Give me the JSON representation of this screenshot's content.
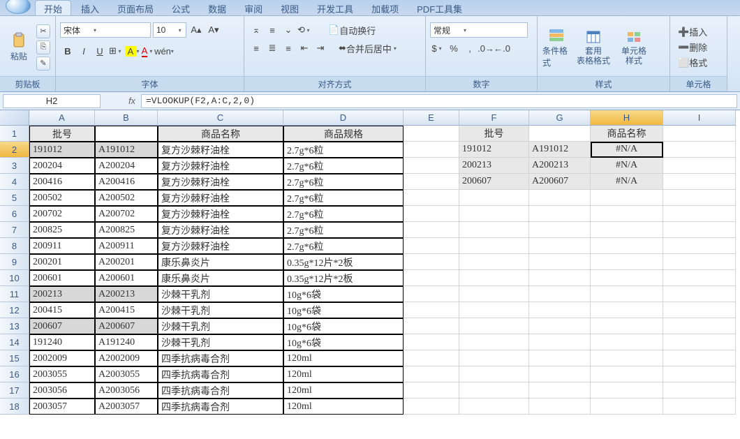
{
  "tabs": [
    "开始",
    "插入",
    "页面布局",
    "公式",
    "数据",
    "审阅",
    "视图",
    "开发工具",
    "加载项",
    "PDF工具集"
  ],
  "activeTab": 0,
  "ribbon": {
    "clipboard": {
      "label": "剪贴板",
      "paste": "粘贴"
    },
    "font": {
      "label": "字体",
      "name": "宋体",
      "size": "10"
    },
    "align": {
      "label": "对齐方式",
      "wrap": "自动换行",
      "merge": "合并后居中"
    },
    "number": {
      "label": "数字",
      "format": "常规"
    },
    "styles": {
      "label": "样式",
      "conditional": "条件格式",
      "table": "套用\n表格格式",
      "cell": "单元格\n样式"
    },
    "cells": {
      "label": "单元格",
      "insert": "插入",
      "delete": "删除",
      "format": "格式"
    }
  },
  "nameBox": "H2",
  "formula": "=VLOOKUP(F2,A:C,2,0)",
  "columns": [
    "A",
    "B",
    "C",
    "D",
    "E",
    "F",
    "G",
    "H",
    "I"
  ],
  "headers": {
    "A1": "批号",
    "C1": "商品名称",
    "D1": "商品规格",
    "F1": "批号",
    "H1": "商品名称"
  },
  "rows": [
    {
      "a": "191012",
      "b": "A191012",
      "c": "复方沙棘籽油栓",
      "d": "2.7g*6粒",
      "f": "191012",
      "g": "A191012",
      "h": "#N/A",
      "hl": true
    },
    {
      "a": "200204",
      "b": "A200204",
      "c": "复方沙棘籽油栓",
      "d": "2.7g*6粒",
      "f": "200213",
      "g": "A200213",
      "h": "#N/A"
    },
    {
      "a": "200416",
      "b": "A200416",
      "c": "复方沙棘籽油栓",
      "d": "2.7g*6粒",
      "f": "200607",
      "g": "A200607",
      "h": "#N/A"
    },
    {
      "a": "200502",
      "b": "A200502",
      "c": "复方沙棘籽油栓",
      "d": "2.7g*6粒"
    },
    {
      "a": "200702",
      "b": "A200702",
      "c": "复方沙棘籽油栓",
      "d": "2.7g*6粒"
    },
    {
      "a": "200825",
      "b": "A200825",
      "c": "复方沙棘籽油栓",
      "d": "2.7g*6粒"
    },
    {
      "a": "200911",
      "b": "A200911",
      "c": "复方沙棘籽油栓",
      "d": "2.7g*6粒"
    },
    {
      "a": "200201",
      "b": "A200201",
      "c": "康乐鼻炎片",
      "d": "0.35g*12片*2板"
    },
    {
      "a": "200601",
      "b": "A200601",
      "c": "康乐鼻炎片",
      "d": "0.35g*12片*2板"
    },
    {
      "a": "200213",
      "b": "A200213",
      "c": "沙棘干乳剂",
      "d": "10g*6袋",
      "hl": true
    },
    {
      "a": "200415",
      "b": "A200415",
      "c": "沙棘干乳剂",
      "d": "10g*6袋"
    },
    {
      "a": "200607",
      "b": "A200607",
      "c": "沙棘干乳剂",
      "d": "10g*6袋",
      "hl": true
    },
    {
      "a": "191240",
      "b": "A191240",
      "c": "沙棘干乳剂",
      "d": "10g*6袋"
    },
    {
      "a": "2002009",
      "b": "A2002009",
      "c": "四季抗病毒合剂",
      "d": "120ml"
    },
    {
      "a": "2003055",
      "b": "A2003055",
      "c": "四季抗病毒合剂",
      "d": "120ml"
    },
    {
      "a": "2003056",
      "b": "A2003056",
      "c": "四季抗病毒合剂",
      "d": "120ml"
    },
    {
      "a": "2003057",
      "b": "A2003057",
      "c": "四季抗病毒合剂",
      "d": "120ml"
    }
  ]
}
